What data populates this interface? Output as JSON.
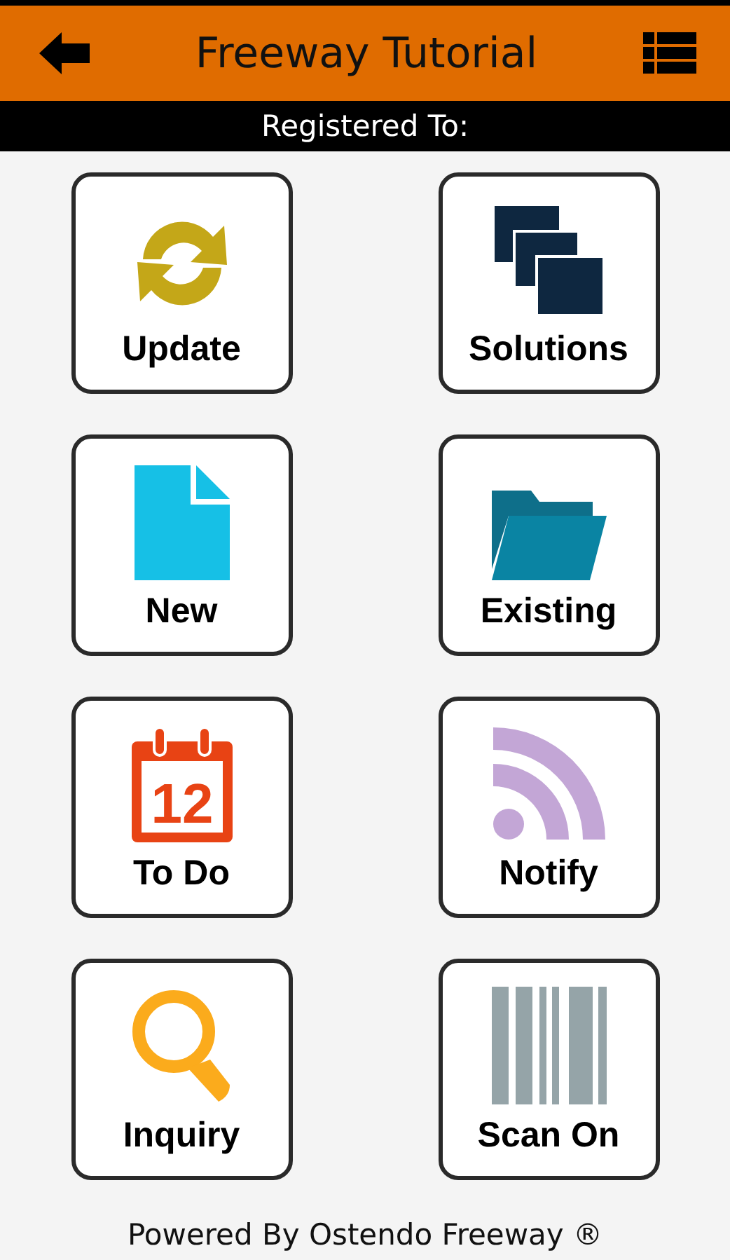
{
  "header": {
    "title": "Freeway Tutorial"
  },
  "registration_bar": {
    "label": "Registered To:"
  },
  "tiles": [
    {
      "label": "Update",
      "kind": "refresh"
    },
    {
      "label": "Solutions",
      "kind": "stack"
    },
    {
      "label": "New",
      "kind": "document"
    },
    {
      "label": "Existing",
      "kind": "folder"
    },
    {
      "label": "To Do",
      "kind": "calendar",
      "icon_text": "12"
    },
    {
      "label": "Notify",
      "kind": "feed"
    },
    {
      "label": "Inquiry",
      "kind": "search"
    },
    {
      "label": "Scan On",
      "kind": "barcode"
    }
  ],
  "footer": {
    "text": "Powered By Ostendo Freeway ®"
  }
}
